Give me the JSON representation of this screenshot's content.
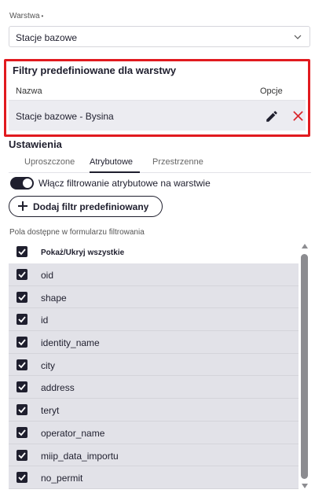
{
  "layer": {
    "label": "Warstwa",
    "required_mark": "•",
    "selected": "Stacje bazowe"
  },
  "filters": {
    "title": "Filtry predefiniowane dla warstwy",
    "col_name": "Nazwa",
    "col_options": "Opcje",
    "rows": [
      {
        "name": "Stacje bazowe - Bysina"
      }
    ]
  },
  "settings": {
    "title": "Ustawienia",
    "tabs": [
      "Uproszczone",
      "Atrybutowe",
      "Przestrzenne"
    ],
    "active_tab": "Atrybutowe",
    "toggle_label": "Włącz filtrowanie atrybutowe na warstwie",
    "toggle_on": true,
    "add_button": "Dodaj filtr predefiniowany"
  },
  "fields": {
    "label": "Pola dostępne w formularzu filtrowania",
    "show_hide_all": "Pokaż/Ukryj wszystkie",
    "items": [
      {
        "name": "oid",
        "checked": true
      },
      {
        "name": "shape",
        "checked": true
      },
      {
        "name": "id",
        "checked": true
      },
      {
        "name": "identity_name",
        "checked": true
      },
      {
        "name": "city",
        "checked": true
      },
      {
        "name": "address",
        "checked": true
      },
      {
        "name": "teryt",
        "checked": true
      },
      {
        "name": "operator_name",
        "checked": true
      },
      {
        "name": "miip_data_importu",
        "checked": true
      },
      {
        "name": "no_permit",
        "checked": true
      }
    ]
  },
  "colors": {
    "accent": "#1f1f2e",
    "highlight_border": "#e11a1f",
    "delete": "#d9262b",
    "row_bg": "#e2e2e8"
  },
  "icons": {
    "edit": "pencil-icon",
    "delete": "close-icon",
    "add": "plus-icon",
    "dropdown": "chevron-down-icon",
    "checkbox": "check-icon"
  }
}
